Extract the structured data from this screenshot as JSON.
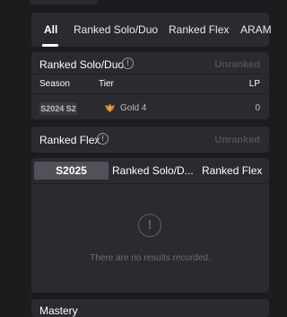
{
  "tabs": [
    {
      "label": "All",
      "active": true
    },
    {
      "label": "Ranked Solo/Duo",
      "active": false
    },
    {
      "label": "Ranked Flex",
      "active": false
    },
    {
      "label": "ARAM",
      "active": false
    }
  ],
  "solo": {
    "title": "Ranked Solo/Duo",
    "status": "Unranked",
    "columns": {
      "season": "Season",
      "tier": "Tier",
      "lp": "LP"
    },
    "rows": [
      {
        "season": "S2024 S2",
        "tier": "Gold 4",
        "lp": "0"
      }
    ]
  },
  "flex": {
    "title": "Ranked Flex",
    "status": "Unranked"
  },
  "results": {
    "season_tab": "S2025",
    "sub_tabs": [
      "Ranked Solo/D...",
      "Ranked Flex"
    ],
    "empty_message": "There are no results recorded."
  },
  "bottom": {
    "title": "Mastery"
  },
  "icons": {
    "info": "info-icon",
    "tier": "gold-tier-icon",
    "empty": "exclamation-circle-icon"
  },
  "colors": {
    "accent_tier": "#c98a3a",
    "panel": "#2a2a30",
    "background": "#1c1c1f"
  }
}
